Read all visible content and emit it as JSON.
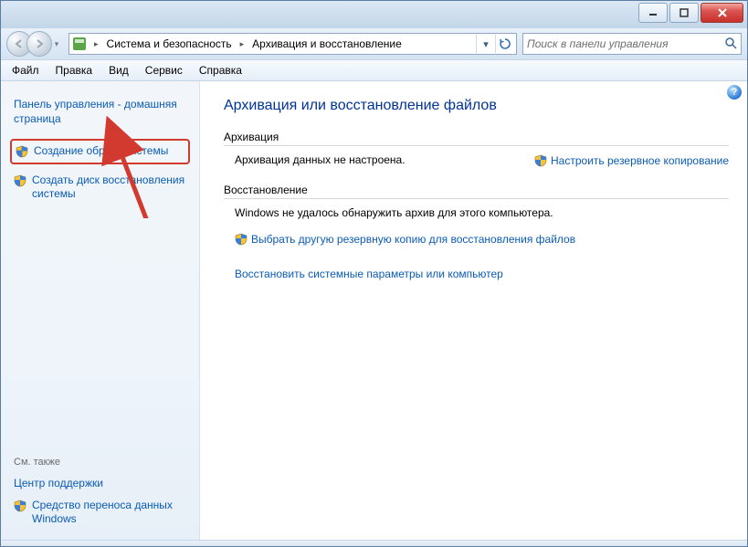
{
  "window_controls": {
    "min": "–",
    "max": "▭",
    "close": "✕"
  },
  "breadcrumb": {
    "level1": "Система и безопасность",
    "level2": "Архивация и восстановление"
  },
  "search": {
    "placeholder": "Поиск в панели управления"
  },
  "menu": {
    "file": "Файл",
    "edit": "Правка",
    "view": "Вид",
    "tools": "Сервис",
    "help": "Справка"
  },
  "sidebar": {
    "home": "Панель управления - домашняя страница",
    "create_image": "Создание образа системы",
    "create_disc": "Создать диск восстановления системы",
    "see_also": "См. также",
    "action_center": "Центр поддержки",
    "easy_transfer": "Средство переноса данных Windows"
  },
  "main": {
    "title": "Архивация или восстановление файлов",
    "backup_head": "Архивация",
    "backup_msg": "Архивация данных не настроена.",
    "backup_link": "Настроить резервное копирование",
    "restore_head": "Восстановление",
    "restore_msg": "Windows не удалось обнаружить архив для этого компьютера.",
    "restore_link1": "Выбрать другую резервную копию для восстановления файлов",
    "restore_link2": "Восстановить системные параметры или компьютер",
    "help": "?"
  }
}
